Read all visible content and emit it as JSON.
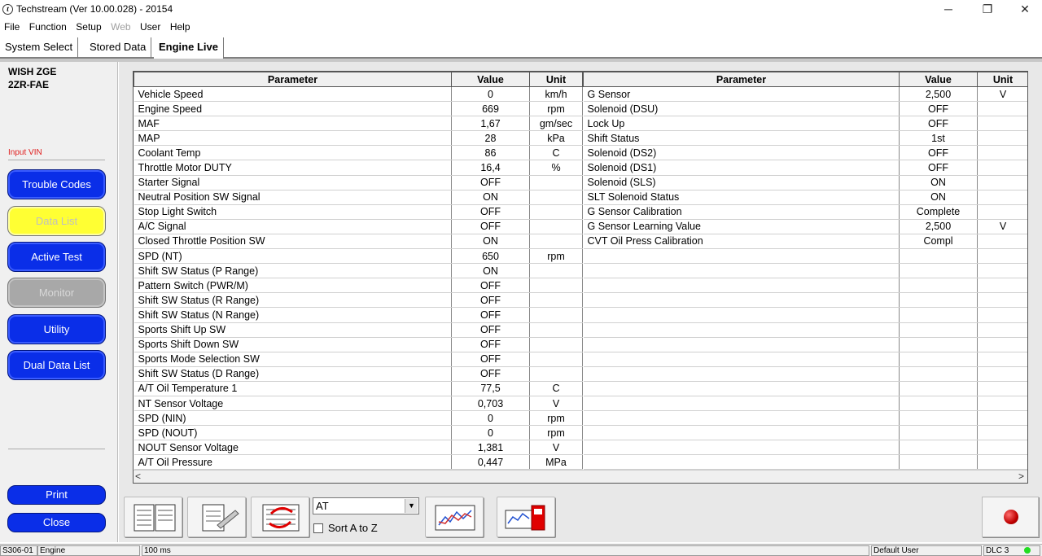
{
  "window": {
    "title": "Techstream (Ver 10.00.028) - 20154",
    "icon_letter": "t",
    "minimize": "─",
    "restore": "❐",
    "close": "✕"
  },
  "menu": [
    "File",
    "Function",
    "Setup",
    "Web",
    "User",
    "Help"
  ],
  "tabs": [
    "System Select",
    "Stored Data",
    "Engine Live"
  ],
  "vehicle": {
    "model": "WISH ZGE",
    "engine": "2ZR-FAE"
  },
  "sidebar": {
    "input_vin": "Input VIN",
    "buttons": [
      "Trouble Codes",
      "Data List",
      "Active Test",
      "Monitor",
      "Utility",
      "Dual Data List"
    ],
    "print": "Print",
    "close": "Close"
  },
  "grid": {
    "headers": {
      "parameter": "Parameter",
      "value": "Value",
      "unit": "Unit"
    },
    "left": [
      [
        "Vehicle Speed",
        "0",
        "km/h"
      ],
      [
        "Engine Speed",
        "669",
        "rpm"
      ],
      [
        "MAF",
        "1,67",
        "gm/sec"
      ],
      [
        "MAP",
        "28",
        "kPa"
      ],
      [
        "Coolant Temp",
        "86",
        "C"
      ],
      [
        "Throttle Motor DUTY",
        "16,4",
        "%"
      ],
      [
        "Starter Signal",
        "OFF",
        ""
      ],
      [
        "Neutral Position SW Signal",
        "ON",
        ""
      ],
      [
        "Stop Light Switch",
        "OFF",
        ""
      ],
      [
        "A/C Signal",
        "OFF",
        ""
      ],
      [
        "Closed Throttle Position SW",
        "ON",
        ""
      ],
      [
        "SPD (NT)",
        "650",
        "rpm"
      ],
      [
        "Shift SW Status (P Range)",
        "ON",
        ""
      ],
      [
        "Pattern Switch (PWR/M)",
        "OFF",
        ""
      ],
      [
        "Shift SW Status (R Range)",
        "OFF",
        ""
      ],
      [
        "Shift SW Status (N Range)",
        "OFF",
        ""
      ],
      [
        "Sports Shift Up SW",
        "OFF",
        ""
      ],
      [
        "Sports Shift Down SW",
        "OFF",
        ""
      ],
      [
        "Sports Mode Selection SW",
        "OFF",
        ""
      ],
      [
        "Shift SW Status (D Range)",
        "OFF",
        ""
      ],
      [
        "A/T Oil Temperature 1",
        "77,5",
        "C"
      ],
      [
        "NT Sensor Voltage",
        "0,703",
        "V"
      ],
      [
        "SPD (NIN)",
        "0",
        "rpm"
      ],
      [
        "SPD (NOUT)",
        "0",
        "rpm"
      ],
      [
        "NOUT Sensor Voltage",
        "1,381",
        "V"
      ],
      [
        "A/T Oil Pressure",
        "0,447",
        "MPa"
      ]
    ],
    "right": [
      [
        "G Sensor",
        "2,500",
        "V"
      ],
      [
        "Solenoid (DSU)",
        "OFF",
        ""
      ],
      [
        "Lock Up",
        "OFF",
        ""
      ],
      [
        "Shift Status",
        "1st",
        ""
      ],
      [
        "Solenoid (DS2)",
        "OFF",
        ""
      ],
      [
        "Solenoid (DS1)",
        "OFF",
        ""
      ],
      [
        "Solenoid (SLS)",
        "ON",
        ""
      ],
      [
        "SLT Solenoid Status",
        "ON",
        ""
      ],
      [
        "G Sensor Calibration",
        "Complete",
        ""
      ],
      [
        "G Sensor Learning Value",
        "2,500",
        "V"
      ],
      [
        "CVT Oil Press Calibration",
        "Compl",
        ""
      ]
    ]
  },
  "toolbar": {
    "dropdown_value": "AT",
    "sort_label": "Sort A to Z"
  },
  "status": {
    "code": "S306-01",
    "system": "Engine",
    "interval": "100 ms",
    "user": "Default User",
    "dlc": "DLC 3"
  },
  "colors": {
    "nav_blue": "#0a2ee8",
    "nav_yellow": "#ffff33",
    "nav_gray": "#a8a8a8",
    "input_vin_red": "#e02020",
    "dlc_green": "#22dd22"
  }
}
